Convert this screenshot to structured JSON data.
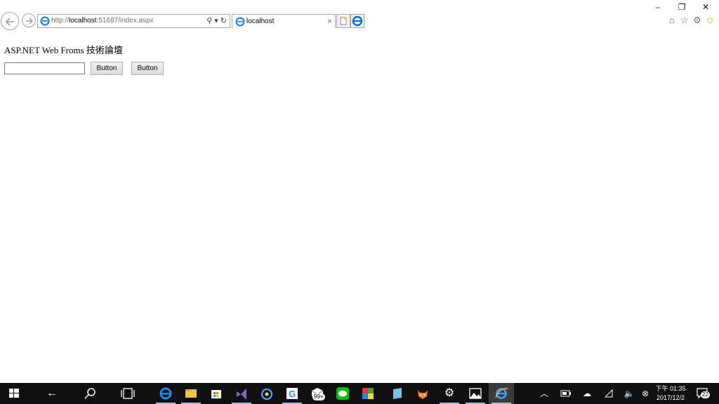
{
  "browser": {
    "address": {
      "scheme": "http://",
      "host": "localhost",
      "rest": ":51687/index.aspx"
    },
    "tab": {
      "title": "localhost",
      "close_glyph": "×"
    },
    "window_controls": {
      "minimize": "–",
      "restore": "❐",
      "close": "✕"
    },
    "icons": [
      "back-icon",
      "forward-icon",
      "search-icon",
      "refresh-icon",
      "home-icon",
      "favorites-icon",
      "settings-icon",
      "feedback-smiley-icon"
    ]
  },
  "page": {
    "heading": "ASP.NET Web Froms 技術論壇",
    "textbox_value": "",
    "buttons": [
      "Button",
      "Button"
    ]
  },
  "taskbar": {
    "search_badge": "99+",
    "clock": {
      "time": "下午 01:35",
      "date": "2017/12/2"
    },
    "notifications": "22"
  },
  "colors": {
    "taskbar": "#101010",
    "accent": "#0078d7"
  }
}
